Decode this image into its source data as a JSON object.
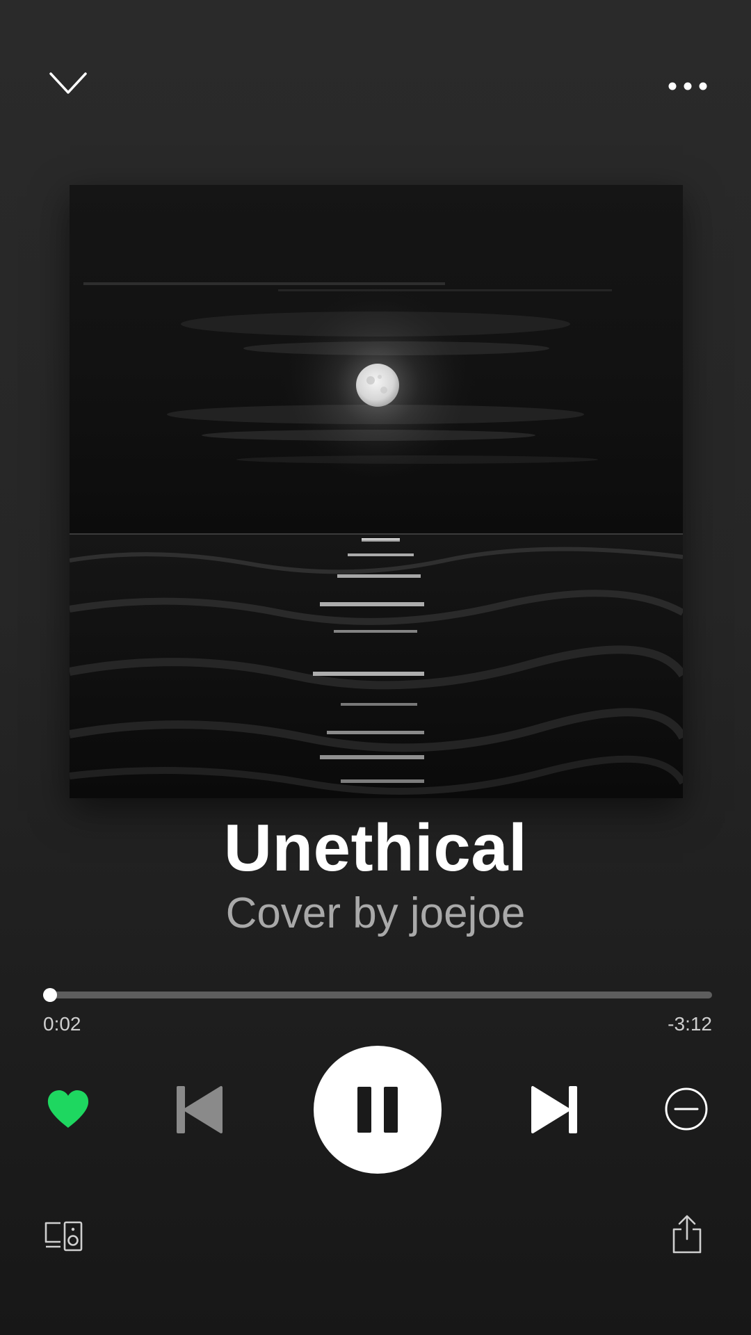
{
  "player": {
    "title": "Unethical",
    "subtitle": "Cover by joejoe",
    "time_elapsed": "0:02",
    "time_remaining": "-3:12",
    "progress_fraction": 0.01,
    "is_playing": true,
    "is_liked": true
  },
  "icons": {
    "collapse": "chevron-down-icon",
    "more": "more-options-icon",
    "like": "heart-icon",
    "previous": "skip-previous-icon",
    "pause": "pause-icon",
    "next": "skip-next-icon",
    "block": "minus-circle-icon",
    "devices": "devices-icon",
    "share": "share-icon"
  },
  "colors": {
    "accent": "#1ed760",
    "background_top": "#2a2a2a",
    "background_bottom": "#171717",
    "subtitle": "#a9a9a9",
    "progress_track": "#5e5e5e",
    "progress_fill": "#d8d8d8",
    "disabled_control": "#8a8a8a"
  }
}
